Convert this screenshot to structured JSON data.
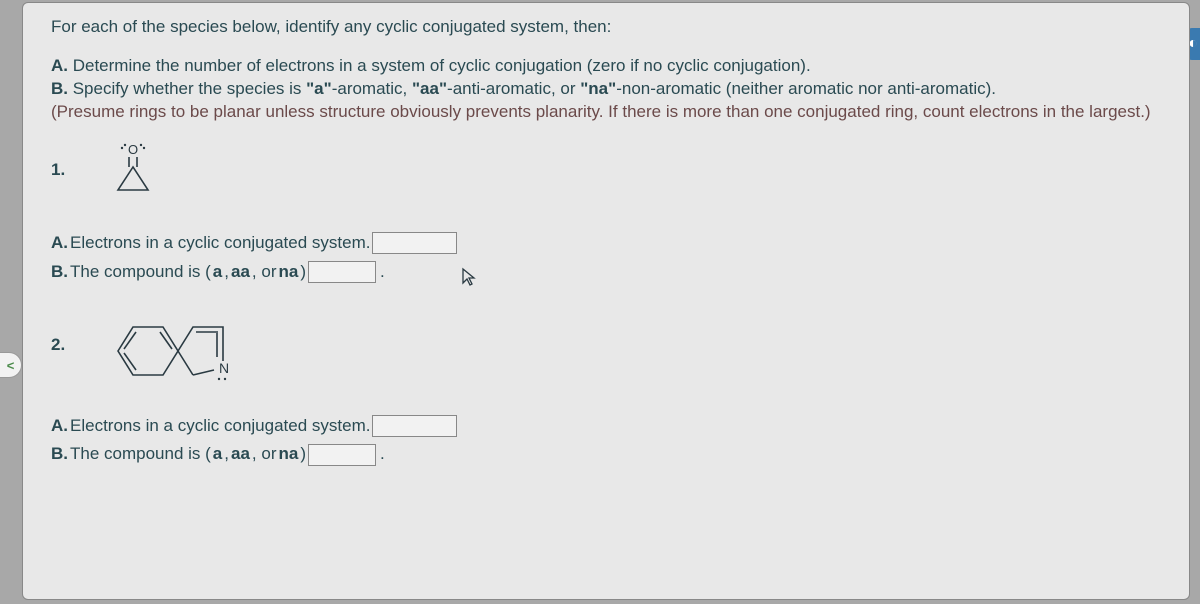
{
  "intro": "For each of the species below, identify any cyclic conjugated system, then:",
  "partA": {
    "prefix": "A.",
    "text": " Determine the number of electrons in a system of cyclic conjugation (zero if no cyclic conjugation)."
  },
  "partB": {
    "prefix": "B.",
    "textStart": " Specify whether the species is ",
    "a": "\"a\"",
    "aText": "-aromatic, ",
    "aa": "\"aa\"",
    "aaText": "-anti-aromatic, or ",
    "na": "\"na\"",
    "naText": "-non-aromatic (neither aromatic nor anti-aromatic)."
  },
  "note": "(Presume rings to be planar unless structure obviously prevents planarity. If there is more than one conjugated ring, count electrons in the largest.)",
  "q1": {
    "num": "1.",
    "answerA": {
      "prefix": "A.",
      "text": "Electrons in a cyclic conjugated system."
    },
    "answerB": {
      "prefix": "B.",
      "text": "The compound is (",
      "a": "a",
      "sep1": ", ",
      "aa": "aa",
      "sep2": ", or ",
      "na": "na",
      "close": ")"
    }
  },
  "q2": {
    "num": "2.",
    "answerA": {
      "prefix": "A.",
      "text": "Electrons in a cyclic conjugated system."
    },
    "answerB": {
      "prefix": "B.",
      "text": "The compound is (",
      "a": "a",
      "sep1": ", ",
      "aa": "aa",
      "sep2": ", or ",
      "na": "na",
      "close": ")"
    }
  },
  "nav": {
    "left": "<"
  }
}
